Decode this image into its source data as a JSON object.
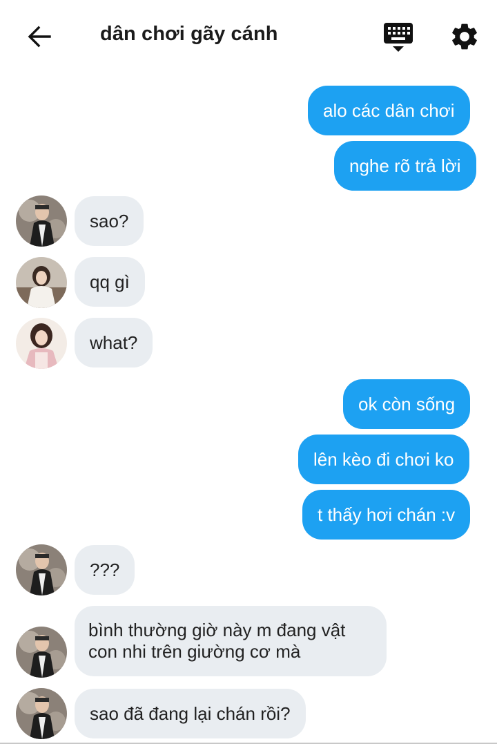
{
  "header": {
    "title": "dân chơi gãy cánh",
    "back_icon": "arrow-left-icon",
    "keyboard_icon": "keyboard-icon",
    "settings_icon": "gear-icon"
  },
  "colors": {
    "outgoing_bubble": "#1da1f2",
    "incoming_bubble": "#e9edf1"
  },
  "messages": [
    {
      "direction": "out",
      "text": "alo các dân chơi"
    },
    {
      "direction": "out",
      "text": "nghe rõ trả lời"
    },
    {
      "direction": "in",
      "text": "sao?"
    },
    {
      "direction": "in",
      "text": "qq gì"
    },
    {
      "direction": "in",
      "text": "what?"
    },
    {
      "direction": "out",
      "text": "ok còn sống"
    },
    {
      "direction": "out",
      "text": "lên kèo đi chơi ko"
    },
    {
      "direction": "out",
      "text": "t thấy hơi chán :v"
    },
    {
      "direction": "in",
      "text": "???"
    },
    {
      "direction": "in",
      "text": "bình thường giờ này m đang vật\ncon nhi trên giường cơ mà"
    },
    {
      "direction": "in",
      "text": "sao đã đang lại chán rồi?"
    }
  ]
}
